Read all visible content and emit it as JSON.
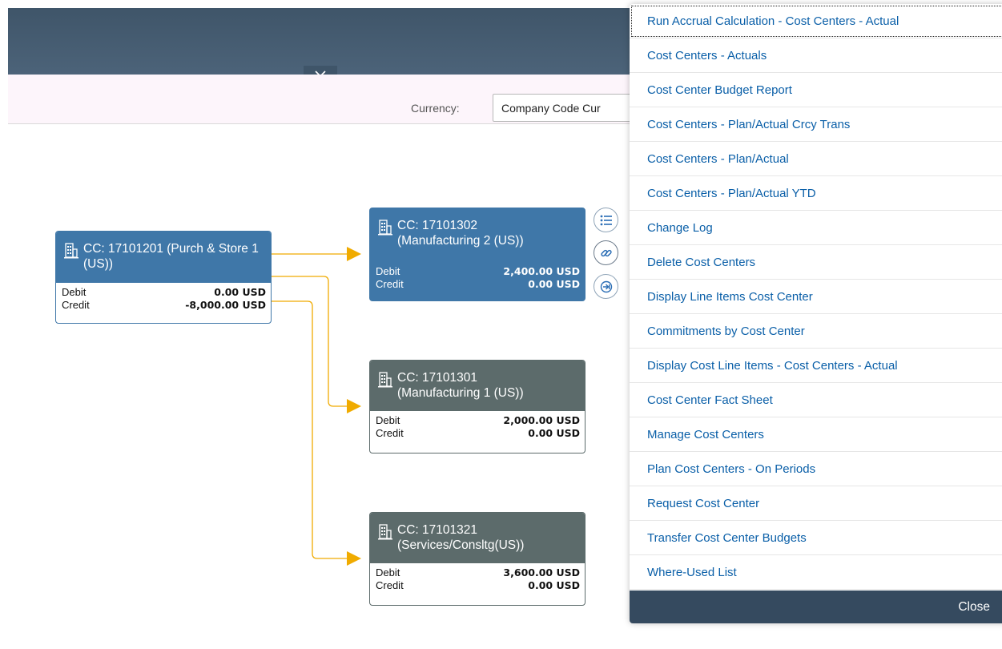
{
  "toolbar": {
    "currency_label": "Currency:",
    "currency_value": "Company Code Cur"
  },
  "nodes": {
    "source": {
      "title": "CC: 17101201 (Purch & Store 1 (US))",
      "debit_label": "Debit",
      "debit_value": "0.00 USD",
      "credit_label": "Credit",
      "credit_value": "-8,000.00 USD"
    },
    "target1": {
      "title_line1": "CC: 17101302",
      "title_line2": "(Manufacturing 2 (US))",
      "debit_label": "Debit",
      "debit_value": "2,400.00 USD",
      "credit_label": "Credit",
      "credit_value": "0.00 USD"
    },
    "target2": {
      "title_line1": "CC: 17101301",
      "title_line2": "(Manufacturing 1 (US))",
      "debit_label": "Debit",
      "debit_value": "2,000.00 USD",
      "credit_label": "Credit",
      "credit_value": "0.00 USD"
    },
    "target3": {
      "title_line1": "CC: 17101321",
      "title_line2": "(Services/Consltg(US))",
      "debit_label": "Debit",
      "debit_value": "3,600.00 USD",
      "credit_label": "Credit",
      "credit_value": "0.00 USD"
    }
  },
  "colors": {
    "header": "#3f5569",
    "node_blue": "#3f77a8",
    "node_grey": "#5c6b6b",
    "connector": "#f0ab00",
    "link": "#0a5fa8",
    "menu_footer": "#354a5f"
  },
  "menu": {
    "items": [
      "Run Accrual Calculation - Cost Centers - Actual",
      "Cost Centers - Actuals",
      "Cost Center Budget Report",
      "Cost Centers - Plan/Actual Crcy Trans",
      "Cost Centers - Plan/Actual",
      "Cost Centers - Plan/Actual YTD",
      "Change Log",
      "Delete Cost Centers",
      "Display Line Items Cost Center",
      "Commitments by Cost Center",
      "Display Cost Line Items - Cost Centers - Actual",
      "Cost Center Fact Sheet",
      "Manage Cost Centers",
      "Plan Cost Centers - On Periods",
      "Request Cost Center",
      "Transfer Cost Center Budgets",
      "Where-Used List"
    ],
    "close_label": "Close"
  },
  "icons": {
    "header_toggle": "chevron-down-icon",
    "node_icon": "building-icon",
    "side_details": "list-icon",
    "side_links": "link-icon",
    "side_drilldown": "drilldown-icon"
  }
}
